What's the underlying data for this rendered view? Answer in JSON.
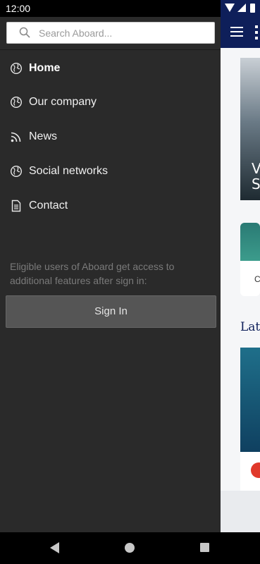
{
  "status_bar": {
    "time": "12:00",
    "icons": [
      "wifi-icon",
      "signal-icon",
      "battery-icon"
    ]
  },
  "drawer": {
    "search": {
      "placeholder": "Search Aboard..."
    },
    "menu_items": [
      {
        "label": "Home",
        "icon": "globe-icon",
        "active": true
      },
      {
        "label": "Our company",
        "icon": "globe-icon",
        "active": false
      },
      {
        "label": "News",
        "icon": "rss-icon",
        "active": false
      },
      {
        "label": "Social networks",
        "icon": "globe-icon",
        "active": false
      },
      {
        "label": "Contact",
        "icon": "document-icon",
        "active": false
      }
    ],
    "signin_note": "Eligible users of Aboard get access to additional features after sign in:",
    "signin_button": "Sign In"
  },
  "background_app": {
    "hero_text": "V\nS",
    "card_text": "C",
    "section_title": "Lat"
  },
  "colors": {
    "drawer_bg": "#2a2a2a",
    "brand_navy": "#0e1f5a",
    "signin_bg": "#555555"
  }
}
